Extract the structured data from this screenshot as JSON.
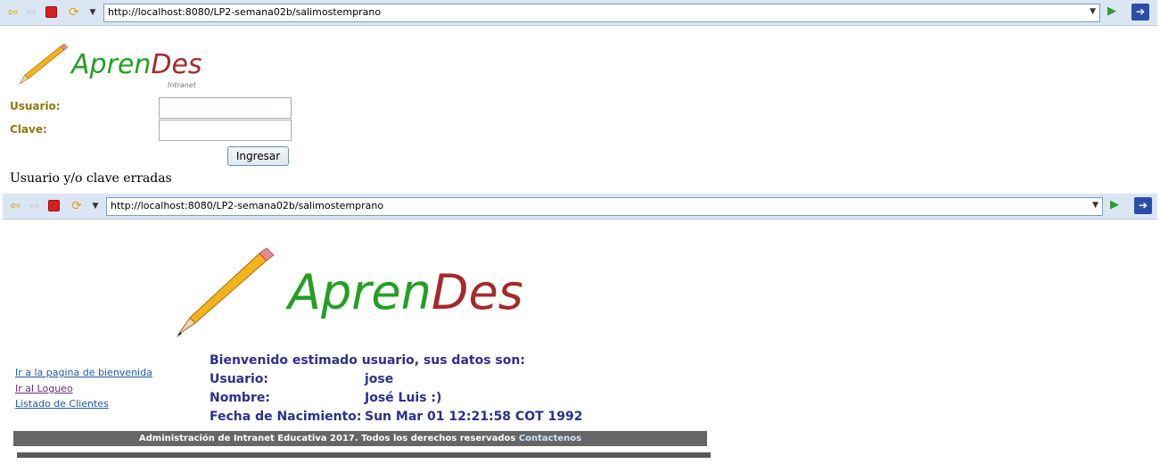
{
  "browser_top": {
    "url": "http://localhost:8080/LP2-semana02b/salimostemprano"
  },
  "login": {
    "brand": {
      "part1": "Apren",
      "part2": "Des",
      "subtitle": "Intranet"
    },
    "usuario_label": "Usuario:",
    "clave_label": "Clave:",
    "usuario_value": "",
    "clave_value": "",
    "submit_label": "Ingresar",
    "error_message": "Usuario y/o clave erradas"
  },
  "browser_bottom": {
    "url": "http://localhost:8080/LP2-semana02b/salimostemprano"
  },
  "welcome": {
    "brand": {
      "part1": "Apren",
      "part2": "Des"
    },
    "links": [
      {
        "label": "Ir a la pagina de bienvenida"
      },
      {
        "label": "Ir al Logueo"
      },
      {
        "label": "Listado de Clientes"
      }
    ],
    "heading": "Bienvenido estimado usuario, sus datos son:",
    "fields": [
      {
        "label": "Usuario:",
        "value": "jose"
      },
      {
        "label": "Nombre:",
        "value": "José Luis :)"
      },
      {
        "label": "Fecha de Nacimiento:",
        "value": "Sun Mar 01 12:21:58 COT 1992"
      }
    ],
    "footer_text": "Administración de Intranet Educativa 2017. Todos los derechos reservados",
    "footer_link": "Contactenos"
  },
  "colors": {
    "brand_green": "#22a022",
    "brand_red": "#a52a2a",
    "label_olive": "#8a7a0c",
    "welcome_navy": "#2d2f8f",
    "footer_gray": "#666666"
  }
}
